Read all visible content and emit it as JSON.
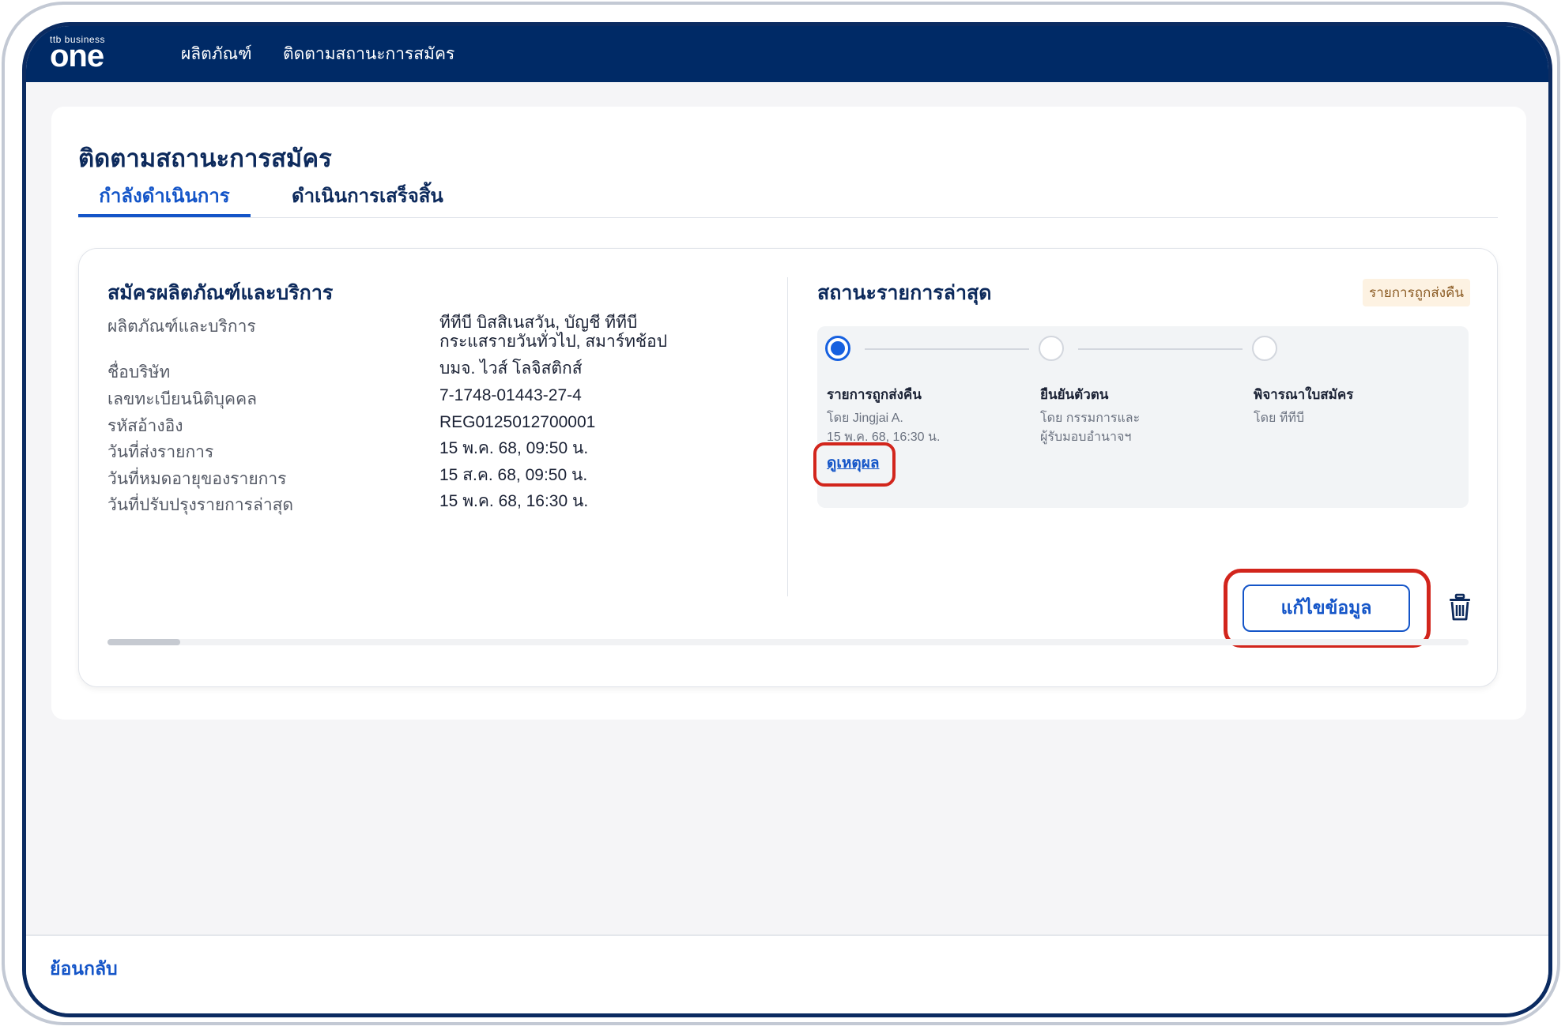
{
  "header": {
    "logo_small": "ttb business",
    "logo_big": "one",
    "nav": [
      "ผลิตภัณฑ์",
      "ติดตามสถานะการสมัคร"
    ]
  },
  "page": {
    "title": "ติดตามสถานะการสมัคร",
    "tabs": [
      "กำลังดำเนินการ",
      "ดำเนินการเสร็จสิ้น"
    ]
  },
  "application": {
    "title": "สมัครผลิตภัณฑ์และบริการ",
    "fields": [
      {
        "label": "ผลิตภัณฑ์และบริการ",
        "value_line1": "ทีทีบี บิสสิเนสวัน, บัญชี ทีทีบี",
        "value_line2": "กระแสรายวันทั่วไป, สมาร์ทช้อป"
      },
      {
        "label": "ชื่อบริษัท",
        "value": "บมจ. ไวส์ โลจิสติกส์"
      },
      {
        "label": "เลขทะเบียนนิติบุคคล",
        "value": "7-1748-01443-27-4"
      },
      {
        "label": "รหัสอ้างอิง",
        "value": "REG0125012700001"
      },
      {
        "label": "วันที่ส่งรายการ",
        "value": "15 พ.ค. 68, 09:50 น."
      },
      {
        "label": "วันที่หมดอายุของรายการ",
        "value": "15 ส.ค. 68, 09:50 น."
      },
      {
        "label": "วันที่ปรับปรุงรายการล่าสุด",
        "value": "15 พ.ค. 68, 16:30 น."
      }
    ]
  },
  "status": {
    "title": "สถานะรายการล่าสุด",
    "badge": "รายการถูกส่งคืน",
    "steps": [
      {
        "title": "รายการถูกส่งคืน",
        "sub1": "โดย Jingjai A.",
        "sub2": "15 พ.ค. 68, 16:30 น."
      },
      {
        "title": "ยืนยันตัวตน",
        "sub1": "โดย กรรมการและ",
        "sub2": "ผู้รับมอบอำนาจฯ"
      },
      {
        "title": "พิจารณาใบสมัคร",
        "sub1": "โดย ทีทีบี"
      }
    ],
    "link": "ดูเหตุผล",
    "edit_button": "แก้ไขข้อมูล"
  },
  "footer": {
    "back": "ย้อนกลับ"
  },
  "colors": {
    "header_bg": "#002a66",
    "accent": "#1455c8",
    "highlight": "#d2251c",
    "badge_bg": "#fdf2e2"
  }
}
